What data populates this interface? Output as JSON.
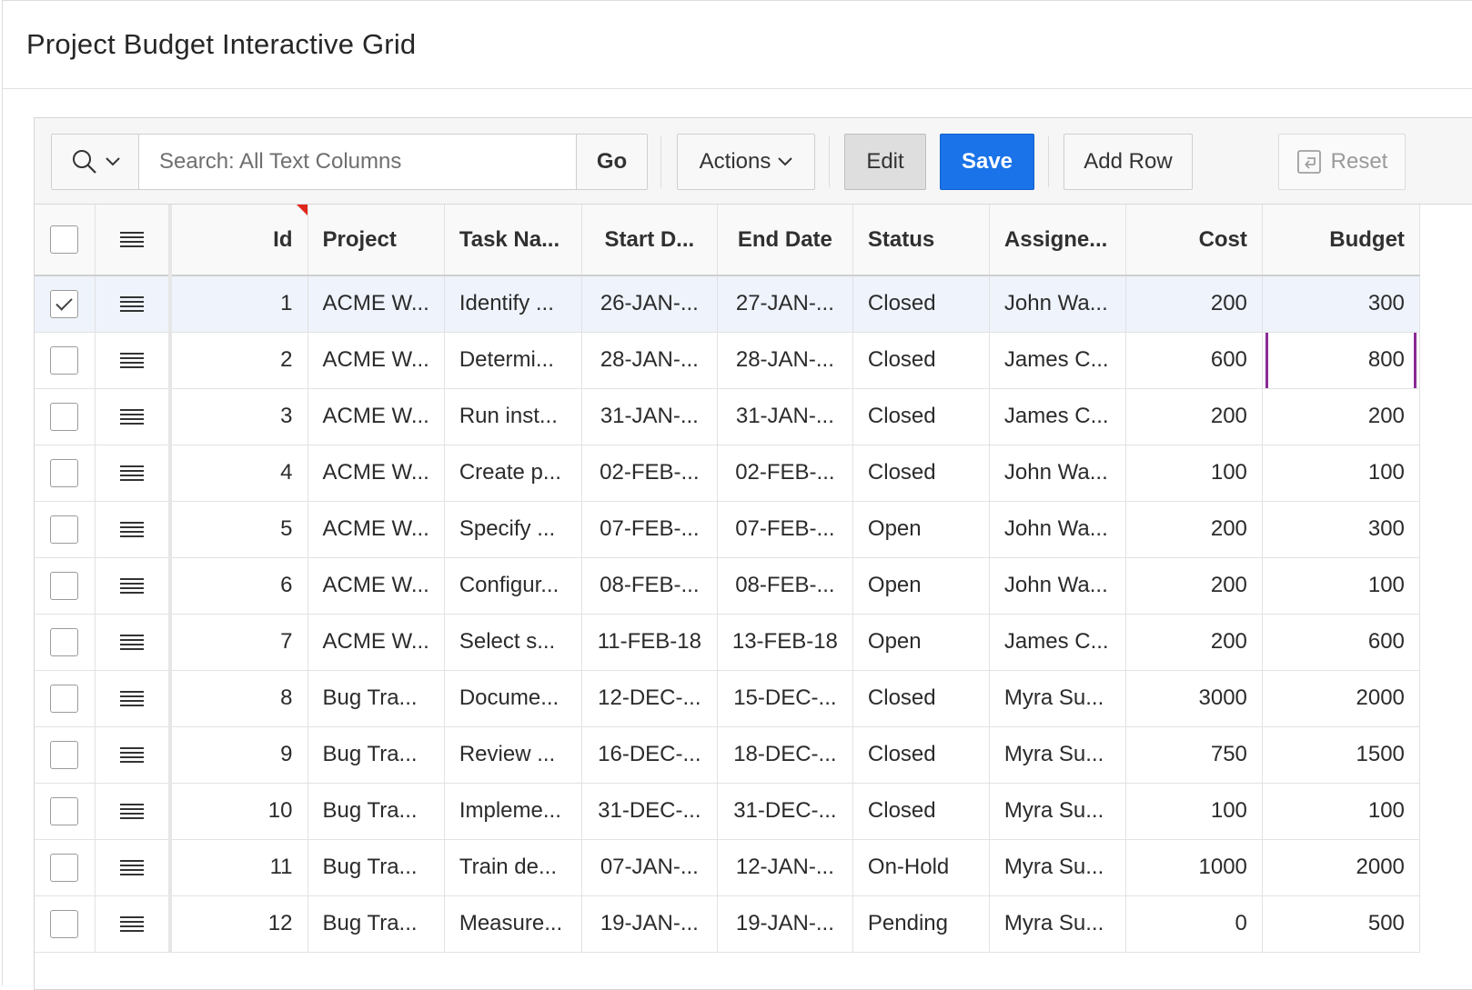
{
  "region": {
    "title": "Project Budget Interactive Grid"
  },
  "toolbar": {
    "search_placeholder": "Search: All Text Columns",
    "go_label": "Go",
    "actions_label": "Actions",
    "edit_label": "Edit",
    "save_label": "Save",
    "add_row_label": "Add Row",
    "reset_label": "Reset",
    "colors": {
      "save_bg": "#1a73e8",
      "active_cell_border": "#8a2a96"
    }
  },
  "grid": {
    "headers": {
      "id": "Id",
      "project": "Project",
      "task": "Task Na...",
      "start": "Start D...",
      "end": "End Date",
      "status": "Status",
      "assignee": "Assigne...",
      "cost": "Cost",
      "budget": "Budget"
    },
    "rows": [
      {
        "id": "1",
        "project": "ACME W...",
        "task": "Identify ...",
        "start": "26-JAN-...",
        "end": "27-JAN-...",
        "status": "Closed",
        "assignee": "John Wa...",
        "cost": "200",
        "budget": "300",
        "selected": true
      },
      {
        "id": "2",
        "project": "ACME W...",
        "task": "Determi...",
        "start": "28-JAN-...",
        "end": "28-JAN-...",
        "status": "Closed",
        "assignee": "James C...",
        "cost": "600",
        "budget": "800",
        "selected": false
      },
      {
        "id": "3",
        "project": "ACME W...",
        "task": "Run inst...",
        "start": "31-JAN-...",
        "end": "31-JAN-...",
        "status": "Closed",
        "assignee": "James C...",
        "cost": "200",
        "budget": "200",
        "selected": false
      },
      {
        "id": "4",
        "project": "ACME W...",
        "task": "Create p...",
        "start": "02-FEB-...",
        "end": "02-FEB-...",
        "status": "Closed",
        "assignee": "John Wa...",
        "cost": "100",
        "budget": "100",
        "selected": false
      },
      {
        "id": "5",
        "project": "ACME W...",
        "task": "Specify ...",
        "start": "07-FEB-...",
        "end": "07-FEB-...",
        "status": "Open",
        "assignee": "John Wa...",
        "cost": "200",
        "budget": "300",
        "selected": false
      },
      {
        "id": "6",
        "project": "ACME W...",
        "task": "Configur...",
        "start": "08-FEB-...",
        "end": "08-FEB-...",
        "status": "Open",
        "assignee": "John Wa...",
        "cost": "200",
        "budget": "100",
        "selected": false
      },
      {
        "id": "7",
        "project": "ACME W...",
        "task": "Select s...",
        "start": "11-FEB-18",
        "end": "13-FEB-18",
        "status": "Open",
        "assignee": "James C...",
        "cost": "200",
        "budget": "600",
        "selected": false
      },
      {
        "id": "8",
        "project": "Bug Tra...",
        "task": "Docume...",
        "start": "12-DEC-...",
        "end": "15-DEC-...",
        "status": "Closed",
        "assignee": "Myra Su...",
        "cost": "3000",
        "budget": "2000",
        "selected": false
      },
      {
        "id": "9",
        "project": "Bug Tra...",
        "task": "Review ...",
        "start": "16-DEC-...",
        "end": "18-DEC-...",
        "status": "Closed",
        "assignee": "Myra Su...",
        "cost": "750",
        "budget": "1500",
        "selected": false
      },
      {
        "id": "10",
        "project": "Bug Tra...",
        "task": "Impleme...",
        "start": "31-DEC-...",
        "end": "31-DEC-...",
        "status": "Closed",
        "assignee": "Myra Su...",
        "cost": "100",
        "budget": "100",
        "selected": false
      },
      {
        "id": "11",
        "project": "Bug Tra...",
        "task": "Train de...",
        "start": "07-JAN-...",
        "end": "12-JAN-...",
        "status": "On-Hold",
        "assignee": "Myra Su...",
        "cost": "1000",
        "budget": "2000",
        "selected": false
      },
      {
        "id": "12",
        "project": "Bug Tra...",
        "task": "Measure...",
        "start": "19-JAN-...",
        "end": "19-JAN-...",
        "status": "Pending",
        "assignee": "Myra Su...",
        "cost": "0",
        "budget": "500",
        "selected": false
      }
    ],
    "active_cell": {
      "row_id": "2",
      "column": "budget"
    }
  }
}
